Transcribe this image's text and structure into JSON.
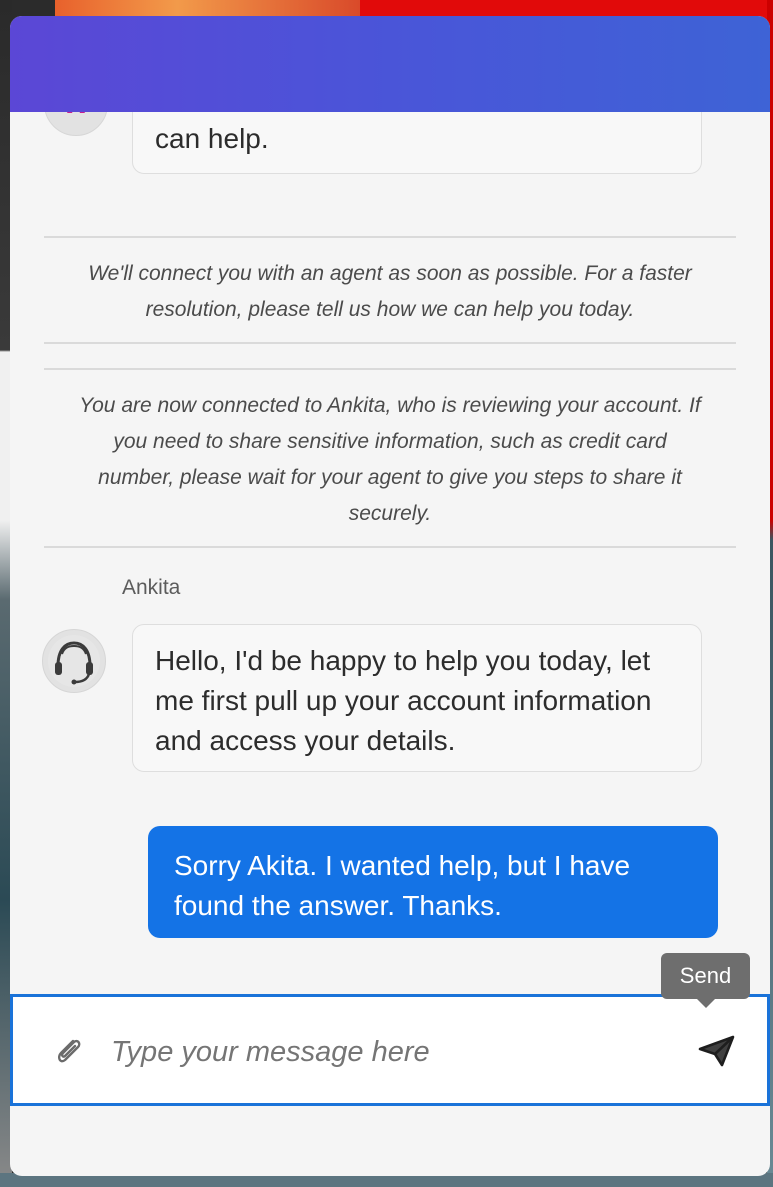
{
  "chat": {
    "prev_bot_message_tail": "can help.",
    "system_notes": [
      "We'll connect you with an agent as soon as possible. For a faster resolution, please tell us how we can help you today.",
      "You are now connected to Ankita, who is reviewing your account. If you need to share sensitive information, such as credit card number, please wait for your agent to give you steps to share it securely."
    ],
    "agent": {
      "name": "Ankita",
      "avatar_icon": "headset-icon",
      "message": "Hello, I'd be happy to help you today, let me first pull up your account information and access your details."
    },
    "user_message": "Sorry Akita. I wanted help, but I have found the answer. Thanks."
  },
  "composer": {
    "placeholder": "Type your message here",
    "attach_icon": "paperclip-icon",
    "send_icon": "paper-plane-icon",
    "send_tooltip": "Send"
  },
  "colors": {
    "header_gradient_start": "#5b47d6",
    "header_gradient_end": "#3e63d6",
    "user_bubble": "#1473e6",
    "composer_border": "#1a73d9",
    "tooltip_bg": "#6e6e6e"
  }
}
